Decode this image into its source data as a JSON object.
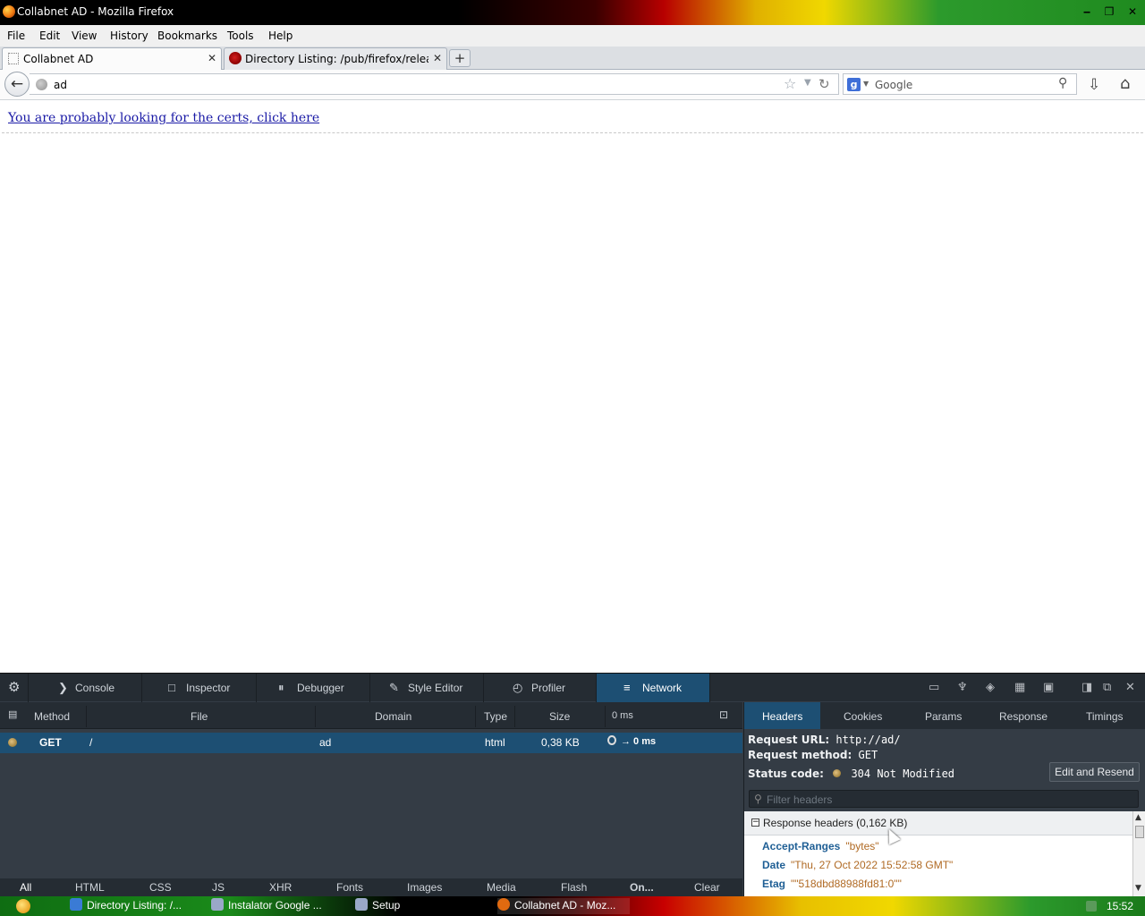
{
  "window": {
    "title": "Collabnet AD - Mozilla Firefox",
    "controls": {
      "minimize": "‒",
      "restore": "❐",
      "close": "✕"
    }
  },
  "menu": [
    "File",
    "Edit",
    "View",
    "History",
    "Bookmarks",
    "Tools",
    "Help"
  ],
  "tabs": [
    {
      "label": "Collabnet AD",
      "close": "✕"
    },
    {
      "label": "Directory Listing: /pub/firefox/release...",
      "close": "✕"
    }
  ],
  "new_tab": "+",
  "nav": {
    "back": "←",
    "url": "ad",
    "search_placeholder": "Google",
    "search_engine": "g",
    "download_icon": "⇩",
    "home_icon": "⌂"
  },
  "page": {
    "link_text": "You are probably looking for the certs, click here"
  },
  "devtools": {
    "gear_icon": "⚙",
    "tabs": [
      {
        "label": "Console",
        "icon": "❯"
      },
      {
        "label": "Inspector",
        "icon": "□"
      },
      {
        "label": "Debugger",
        "icon": "⏸"
      },
      {
        "label": "Style Editor",
        "icon": "✎"
      },
      {
        "label": "Profiler",
        "icon": "◴"
      },
      {
        "label": "Network",
        "icon": "≡"
      }
    ],
    "selected_tab": "Network",
    "network": {
      "columns": [
        "Method",
        "File",
        "Domain",
        "Type",
        "Size",
        "0 ms"
      ],
      "rows": [
        {
          "method": "GET",
          "file": "/",
          "domain": "ad",
          "type": "html",
          "size": "0,38 KB",
          "timing": "→ 0 ms"
        }
      ],
      "filters": [
        "All",
        "HTML",
        "CSS",
        "JS",
        "XHR",
        "Fonts",
        "Images",
        "Media",
        "Flash",
        "On...",
        "Clear"
      ],
      "selected_filter": "All"
    },
    "sidebar": {
      "tabs": [
        "Headers",
        "Cookies",
        "Params",
        "Response",
        "Timings"
      ],
      "selected_tab": "Headers",
      "request_url_label": "Request URL:",
      "request_url": "http://ad/",
      "request_method_label": "Request method:",
      "request_method": "GET",
      "status_code_label": "Status code:",
      "status_code": "304 Not Modified",
      "edit_resend": "Edit and Resend",
      "filter_placeholder": "Filter headers",
      "response_headers_title": "Response headers (0,162 KB)",
      "response_headers": [
        {
          "key": "Accept-Ranges",
          "value": "\"bytes\""
        },
        {
          "key": "Date",
          "value": "\"Thu, 27 Oct 2022 15:52:58 GMT\""
        },
        {
          "key": "Etag",
          "value": "\"\"518dbd88988fd81:0\"\""
        }
      ]
    }
  },
  "taskbar": {
    "items": [
      {
        "label": "Directory Listing: /...",
        "color": "#3a7bd5"
      },
      {
        "label": "Instalator Google ...",
        "color": "#9aa8c8"
      },
      {
        "label": "Setup",
        "color": "#9aa8c8"
      },
      {
        "label": "Collabnet AD - Moz...",
        "color": "#e06a10"
      }
    ],
    "clock": "15:52"
  }
}
